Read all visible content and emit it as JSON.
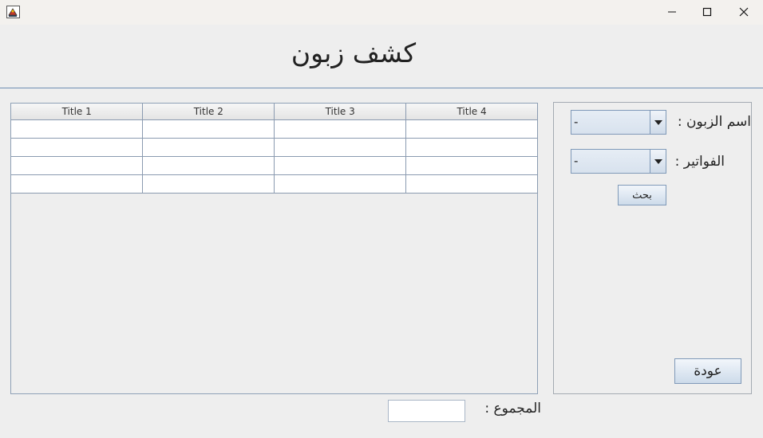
{
  "window": {
    "icon": "java-app-icon",
    "controls": [
      "minimize-icon",
      "maximize-icon",
      "close-icon"
    ]
  },
  "heading": "كشف زبون",
  "table": {
    "columns": [
      "Title 1",
      "Title 2",
      "Title 3",
      "Title 4"
    ],
    "rows": [
      [
        "",
        "",
        "",
        ""
      ],
      [
        "",
        "",
        "",
        ""
      ],
      [
        "",
        "",
        "",
        ""
      ],
      [
        "",
        "",
        "",
        ""
      ]
    ]
  },
  "side": {
    "customer_label": "اسم الزبون :",
    "customer_value": "-",
    "invoices_label": "الفواتير :",
    "invoices_value": "-",
    "search_label": "بحث",
    "back_label": "عودة"
  },
  "total": {
    "label": "المجموع :",
    "value": ""
  }
}
